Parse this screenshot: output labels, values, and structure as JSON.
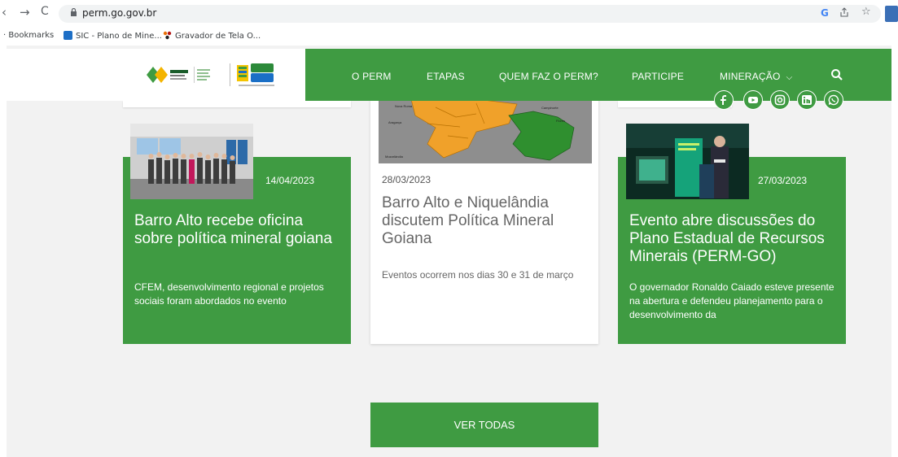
{
  "browser": {
    "back_icon": "back-arrow-icon",
    "forward": "→",
    "reload": "C",
    "url": "perm.go.gov.br",
    "right_icons": [
      "G",
      "share-icon",
      "☆"
    ]
  },
  "bookmarks": {
    "label": "Bookmarks",
    "items": [
      {
        "label": "SIC - Plano de Mine..."
      },
      {
        "label": "Gravador de Tela O..."
      }
    ]
  },
  "header": {
    "menu": [
      {
        "label": "O PERM"
      },
      {
        "label": "ETAPAS"
      },
      {
        "label": "QUEM FAZ O PERM?"
      },
      {
        "label": "PARTICIPE"
      },
      {
        "label": "MINERAÇÃO"
      }
    ],
    "dropdown_arrow": "⌵"
  },
  "social": [
    "facebook-icon",
    "youtube-icon",
    "instagram-icon",
    "linkedin-icon",
    "whatsapp-icon"
  ],
  "news": [
    {
      "date": "14/04/2023",
      "title": "Barro Alto recebe oficina sobre política mineral goiana",
      "excerpt": "CFEM, desenvolvimento regional e projetos sociais foram abordados no evento"
    },
    {
      "date": "28/03/2023",
      "title": "Barro Alto e Niquelândia discutem Política Mineral Goiana",
      "excerpt": "Eventos ocorrem nos dias 30 e 31 de março"
    },
    {
      "date": "27/03/2023",
      "title": "Evento abre discussões do Plano Estadual de Recursos Minerais (PERM-GO)",
      "excerpt": "O governador Ronaldo Caiado esteve presente na abertura e defendeu planejamento para o desenvolvimento da"
    }
  ],
  "ver_todas": "VER TODAS",
  "colors": {
    "brand_green": "#3f9b42",
    "map_orange": "#f0a12a"
  }
}
